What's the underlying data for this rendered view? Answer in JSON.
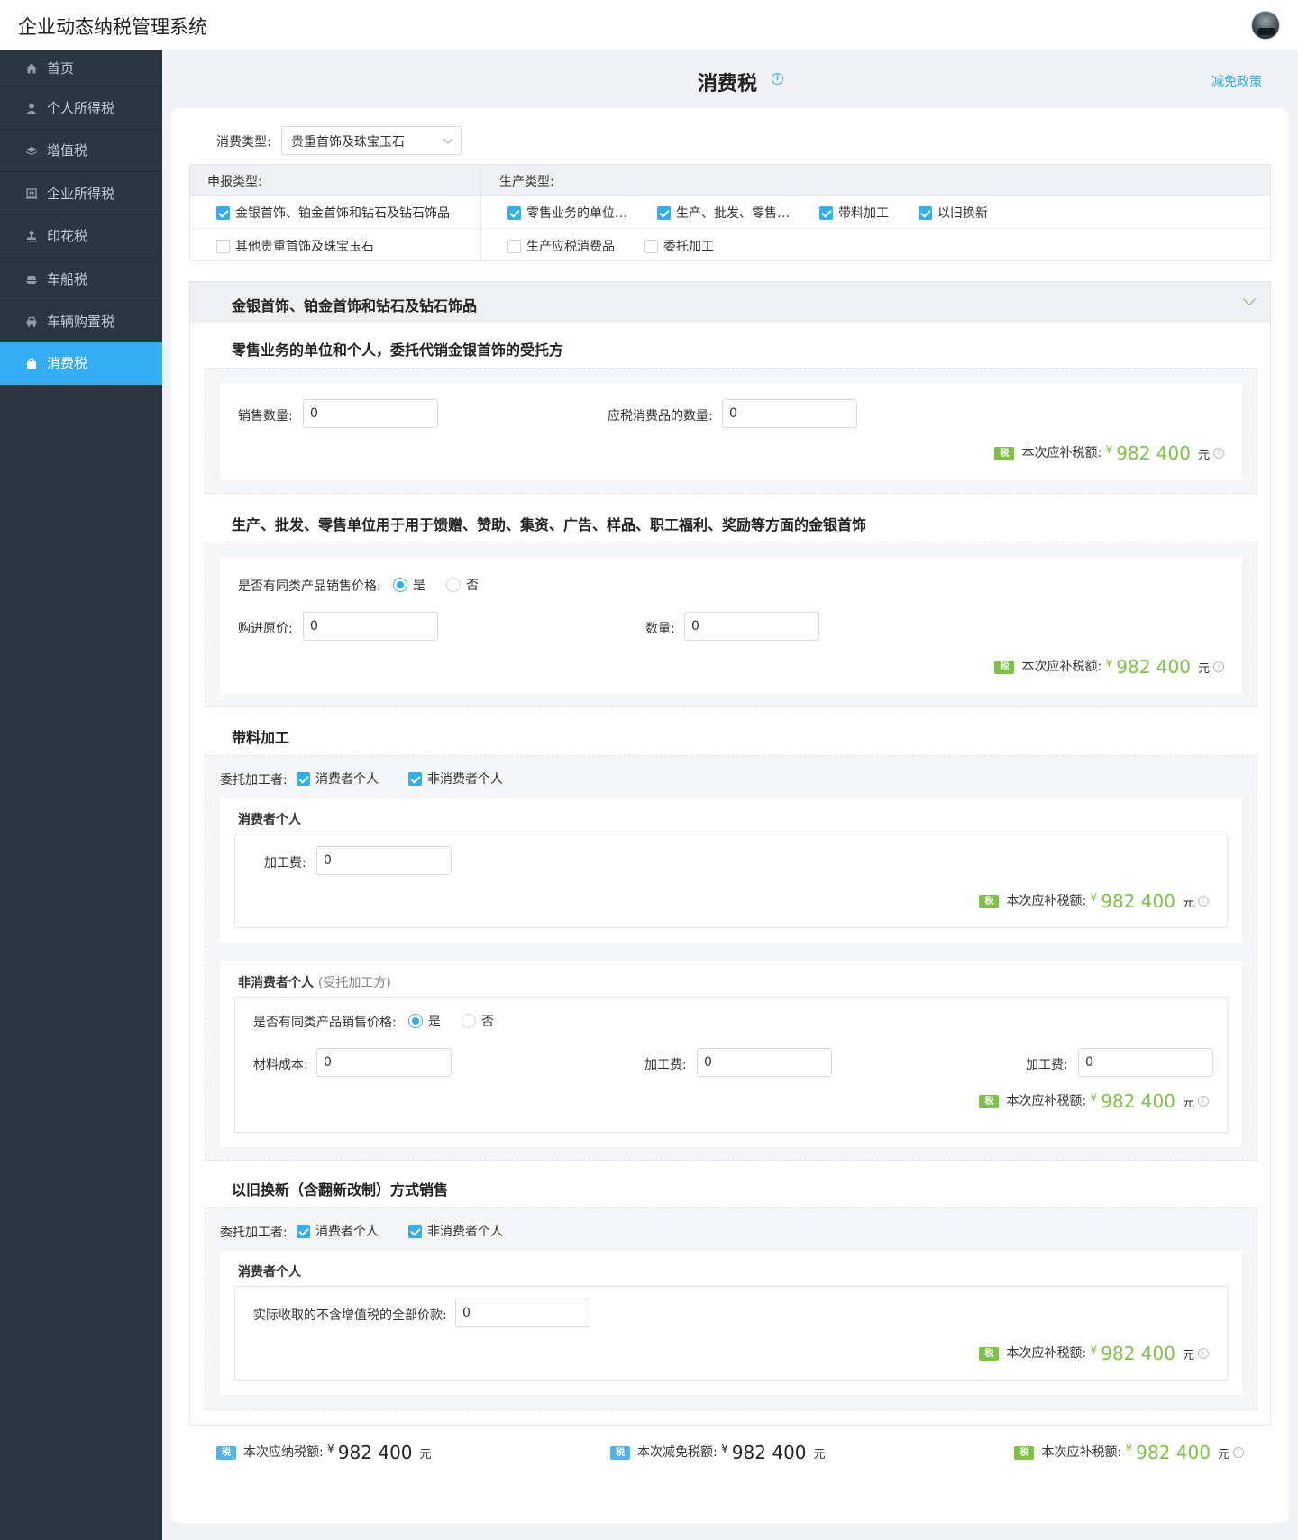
{
  "app": {
    "title": "企业动态纳税管理系统"
  },
  "sidebar": {
    "items": [
      {
        "label": "首页",
        "icon": "home-icon"
      },
      {
        "label": "个人所得税",
        "icon": "person-icon"
      },
      {
        "label": "增值税",
        "icon": "layers-icon"
      },
      {
        "label": "企业所得税",
        "icon": "building-icon"
      },
      {
        "label": "印花税",
        "icon": "stamp-icon"
      },
      {
        "label": "车船税",
        "icon": "boat-icon"
      },
      {
        "label": "车辆购置税",
        "icon": "car-icon"
      },
      {
        "label": "消费税",
        "icon": "bag-icon",
        "active": true
      }
    ]
  },
  "header": {
    "title": "消费税",
    "policy_link": "减免政策"
  },
  "form": {
    "consume_type_label": "消费类型:",
    "consume_type_value": "贵重首饰及珠宝玉石",
    "declare_type_label": "申报类型:",
    "production_type_label": "生产类型:",
    "declare_options": [
      {
        "label": "金银首饰、铂金首饰和钻石及钻石饰品",
        "checked": true
      },
      {
        "label": "其他贵重首饰及珠宝玉石",
        "checked": false
      }
    ],
    "production_options": [
      {
        "label": "零售业务的单位…",
        "checked": true
      },
      {
        "label": "生产、批发、零售…",
        "checked": true
      },
      {
        "label": "带料加工",
        "checked": true
      },
      {
        "label": "以旧换新",
        "checked": true
      },
      {
        "label": "生产应税消费品",
        "checked": false
      },
      {
        "label": "委托加工",
        "checked": false
      }
    ]
  },
  "panel": {
    "title": "金银首饰、铂金首饰和钻石及钻石饰品"
  },
  "common": {
    "tax_label": "本次应补税额:",
    "currency": "¥",
    "unit": "元",
    "tax_badge": "税",
    "yes": "是",
    "no": "否",
    "same_price_label": "是否有同类产品销售价格:",
    "consignor_label": "委托加工者:",
    "consumer_individual": "消费者个人",
    "non_consumer_individual": "非消费者个人"
  },
  "sec1": {
    "title": "零售业务的单位和个人，委托代销金银首饰的受托方",
    "sales_qty_label": "销售数量:",
    "sales_qty_value": "0",
    "taxable_qty_label": "应税消费品的数量:",
    "taxable_qty_value": "0",
    "amount": "982 400"
  },
  "sec2": {
    "title": "生产、批发、零售单位用于用于馈赠、赞助、集资、广告、样品、职工福利、奖励等方面的金银首饰",
    "purchase_price_label": "购进原价:",
    "purchase_price_value": "0",
    "qty_label": "数量:",
    "qty_value": "0",
    "amount": "982 400"
  },
  "sec3": {
    "title": "带料加工",
    "consumer": {
      "title": "消费者个人",
      "fee_label": "加工费:",
      "fee_value": "0",
      "amount": "982 400"
    },
    "non_consumer": {
      "title": "非消费者个人",
      "note": "(受托加工方)",
      "material_cost_label": "材料成本:",
      "material_cost_value": "0",
      "fee_label": "加工费:",
      "fee_value": "0",
      "fee2_label": "加工费:",
      "fee2_value": "0",
      "amount": "982 400"
    }
  },
  "sec4": {
    "title": "以旧换新（含翻新改制）方式销售",
    "consumer": {
      "title": "消费者个人",
      "price_label": "实际收取的不含增值税的全部价款:",
      "price_value": "0",
      "amount": "982 400"
    }
  },
  "summary": {
    "payable_label": "本次应纳税额:",
    "payable_amount": "982 400",
    "reduced_label": "本次减免税额:",
    "reduced_amount": "982 400",
    "supplement_label": "本次应补税额:",
    "supplement_amount": "982 400"
  },
  "colors": {
    "accent": "#33aef4",
    "sidebar_bg": "#293743",
    "amount_green": "#7dc242"
  }
}
